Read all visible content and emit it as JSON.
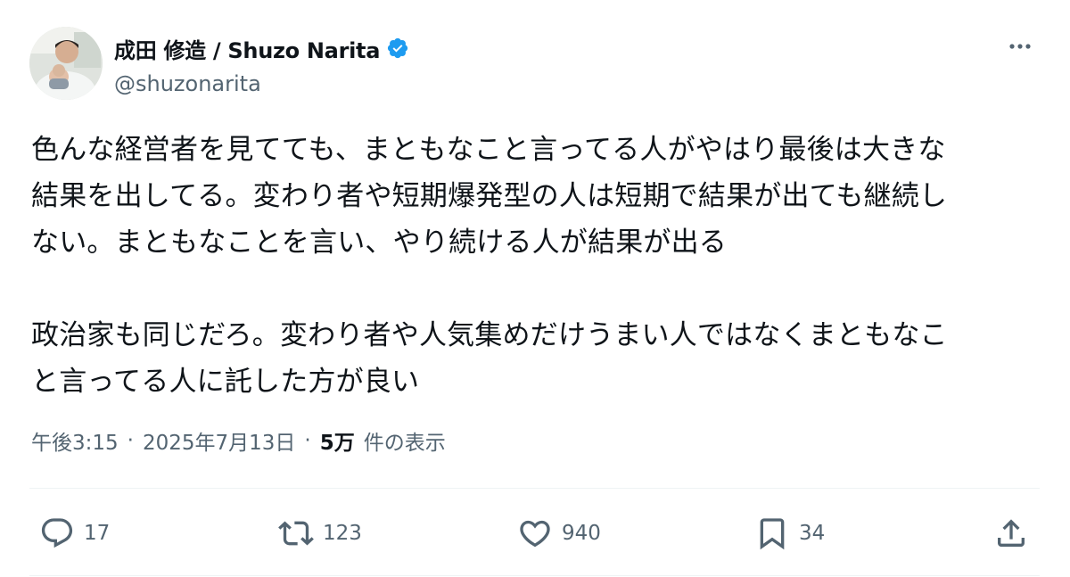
{
  "author": {
    "display_name": "成田 修造 / Shuzo Narita",
    "handle": "@shuzonarita",
    "verified": true,
    "verified_color": "#1d9bf0"
  },
  "post": {
    "text": "色んな経営者を見てても、まともなこと言ってる人がやはり最後は大きな\n結果を出してる。変わり者や短期爆発型の人は短期で結果が出ても継続し\nない。まともなことを言い、やり続ける人が結果が出る\n\n政治家も同じだろ。変わり者や人気集めだけうまい人ではなくまともなこ\nと言ってる人に託した方が良い"
  },
  "meta": {
    "time": "午後3:15",
    "separator": "·",
    "date": "2025年7月13日",
    "views_count": "5万",
    "views_label": "件の表示"
  },
  "actions": {
    "replies": "17",
    "retweets": "123",
    "likes": "940",
    "bookmarks": "34"
  },
  "icons": {
    "more": "more-horizontal-icon",
    "reply": "reply-icon",
    "retweet": "retweet-icon",
    "like": "heart-icon",
    "bookmark": "bookmark-icon",
    "share": "share-icon"
  }
}
